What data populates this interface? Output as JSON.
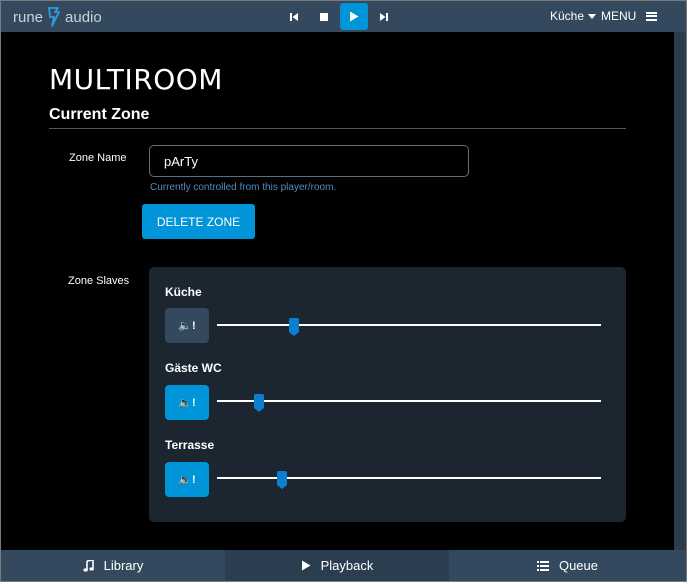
{
  "app": {
    "logo_rune": "rune",
    "logo_audio": "audio"
  },
  "colors": {
    "topbar": "#34495e",
    "accent": "#0095d8",
    "panel": "#1b2631",
    "help_text": "#4e8bbd"
  },
  "transport": {
    "prev_icon": "previous-icon",
    "stop_icon": "stop-icon",
    "play_icon": "play-icon",
    "next_icon": "next-icon",
    "active": "play"
  },
  "header": {
    "zone_selector": "Küche",
    "menu_label": "MENU"
  },
  "page": {
    "title": "MULTIROOM",
    "section": "Current Zone"
  },
  "zone_form": {
    "name_label": "Zone Name",
    "name_value": "pArTy",
    "help_text": "Currently controlled from this player/room.",
    "delete_label": "DELETE ZONE",
    "slaves_label": "Zone Slaves"
  },
  "slaves": [
    {
      "name": "Küche",
      "mute_glyph": "🔈!",
      "muted": false,
      "volume": 0.2
    },
    {
      "name": "Gäste WC",
      "mute_glyph": "🔈!",
      "muted": true,
      "volume": 0.11
    },
    {
      "name": "Terrasse",
      "mute_glyph": "🔈!",
      "muted": true,
      "volume": 0.17
    }
  ],
  "bottom_nav": [
    {
      "label": "Library",
      "icon": "music-note-icon",
      "active": false
    },
    {
      "label": "Playback",
      "icon": "play-icon",
      "active": true
    },
    {
      "label": "Queue",
      "icon": "list-icon",
      "active": false
    }
  ]
}
